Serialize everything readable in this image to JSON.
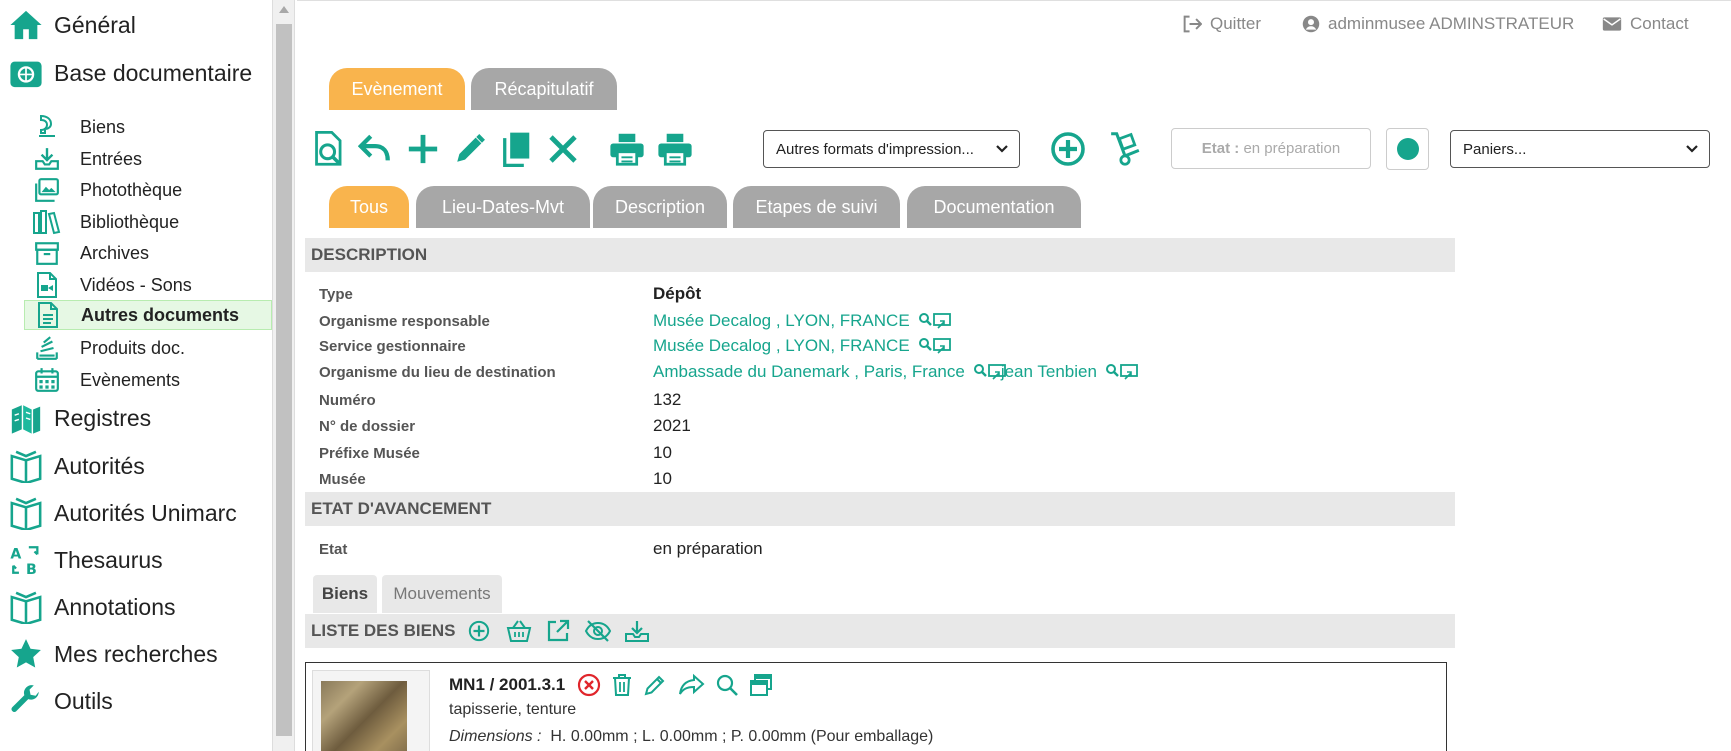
{
  "sidebar": {
    "top_items": [
      {
        "label": "Général",
        "icon": "home-icon"
      },
      {
        "label": "Base documentaire",
        "icon": "database-icon"
      },
      {
        "label": "Registres",
        "icon": "registers-icon"
      },
      {
        "label": "Autorités",
        "icon": "book-open-icon"
      },
      {
        "label": "Autorités Unimarc",
        "icon": "book-open-icon"
      },
      {
        "label": "Thesaurus",
        "icon": "thesaurus-icon"
      },
      {
        "label": "Annotations",
        "icon": "book-open-icon"
      },
      {
        "label": "Mes recherches",
        "icon": "star-icon"
      },
      {
        "label": "Outils",
        "icon": "wrench-icon"
      }
    ],
    "sub_items": [
      {
        "label": "Biens",
        "icon": "object-icon"
      },
      {
        "label": "Entrées",
        "icon": "inbox-download-icon"
      },
      {
        "label": "Photothèque",
        "icon": "photos-icon"
      },
      {
        "label": "Bibliothèque",
        "icon": "library-icon"
      },
      {
        "label": "Archives",
        "icon": "archive-box-icon"
      },
      {
        "label": "Vidéos - Sons",
        "icon": "video-file-icon"
      },
      {
        "label": "Autres documents",
        "icon": "document-icon",
        "active": true
      },
      {
        "label": "Produits doc.",
        "icon": "doc-stack-icon"
      },
      {
        "label": "Evènements",
        "icon": "calendar-icon"
      }
    ]
  },
  "topnav": {
    "quit": "Quitter",
    "user": "adminmusee ADMINSTRATEUR",
    "contact": "Contact"
  },
  "main_tabs": {
    "event": "Evènement",
    "summary": "Récapitulatif"
  },
  "toolbar": {
    "print_formats": "Autres formats d'impression...",
    "state_label": "Etat :",
    "state_value": "en préparation",
    "baskets": "Paniers..."
  },
  "sub_tabs": [
    "Tous",
    "Lieu-Dates-Mvt",
    "Description",
    "Etapes de suivi",
    "Documentation"
  ],
  "description": {
    "heading": "DESCRIPTION",
    "type_label": "Type",
    "type_value": "Dépôt",
    "org_resp_label": "Organisme responsable",
    "org_resp_value": "Musée Decalog , LYON, FRANCE",
    "service_label": "Service gestionnaire",
    "service_value": "Musée Decalog , LYON, FRANCE",
    "org_dest_label": "Organisme du lieu de destination",
    "org_dest_value": "Ambassade du Danemark , Paris, France",
    "org_dest_person": "jean Tenbien",
    "numero_label": "Numéro",
    "numero_value": "132",
    "dossier_label": "N° de dossier",
    "dossier_value": "2021",
    "prefixe_label": "Préfixe Musée",
    "prefixe_value": "10",
    "musee_label": "Musée",
    "musee_value": "10"
  },
  "progress": {
    "heading": "ETAT D'AVANCEMENT",
    "state_label": "Etat",
    "state_value": "en préparation"
  },
  "list_tabs": {
    "biens": "Biens",
    "mouvements": "Mouvements"
  },
  "list": {
    "heading": "LISTE DES BIENS",
    "item_title": "MN1 / 2001.3.1",
    "item_desc": "tapisserie, tenture",
    "dimensions_label": "Dimensions :",
    "dimensions_value": "H. 0.00mm ; L. 0.00mm ; P. 0.00mm (Pour emballage)"
  },
  "colors": {
    "accent": "#16a58d",
    "tab_active": "#f9b44d",
    "tab_inactive": "#a7a7a7",
    "danger": "#e0252b"
  }
}
